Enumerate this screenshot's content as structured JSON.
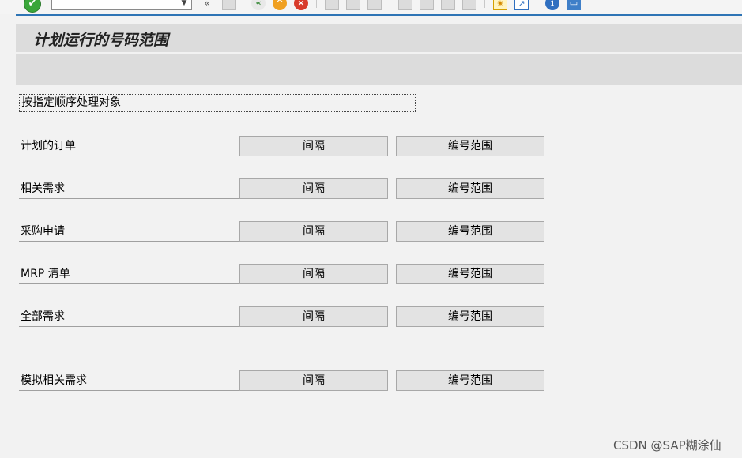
{
  "title": "计划运行的号码范围",
  "process_label": "按指定顺序处理对象",
  "rows": [
    {
      "label": "计划的订单",
      "interval_btn": "间隔",
      "range_btn": "编号范围"
    },
    {
      "label": "相关需求",
      "interval_btn": "间隔",
      "range_btn": "编号范围"
    },
    {
      "label": "采购申请",
      "interval_btn": "间隔",
      "range_btn": "编号范围"
    },
    {
      "label": "MRP 清单",
      "interval_btn": "间隔",
      "range_btn": "编号范围"
    },
    {
      "label": "全部需求",
      "interval_btn": "间隔",
      "range_btn": "编号范围"
    },
    {
      "label": "模拟相关需求",
      "interval_btn": "间隔",
      "range_btn": "编号范围"
    }
  ],
  "toolbar": {
    "command_value": "",
    "icons": {
      "ok": "enter-check-icon",
      "expand": "double-left-chevron-icon",
      "save": "save-icon",
      "back": "back-icon",
      "exit": "exit-icon",
      "cancel": "cancel-icon",
      "print": "print-icon",
      "find": "find-icon",
      "find_next": "find-next-icon",
      "first_page": "first-page-icon",
      "prev_page": "previous-page-icon",
      "next_page": "next-page-icon",
      "last_page": "last-page-icon",
      "new_session": "new-session-icon",
      "shortcut": "create-shortcut-icon",
      "help": "help-icon",
      "layout": "customize-layout-icon"
    }
  },
  "watermark": "CSDN @SAP糊涂仙",
  "colors": {
    "accent_line": "#2e74b5",
    "title_bar": "#dcdcdc",
    "background": "#f2f2f2"
  }
}
